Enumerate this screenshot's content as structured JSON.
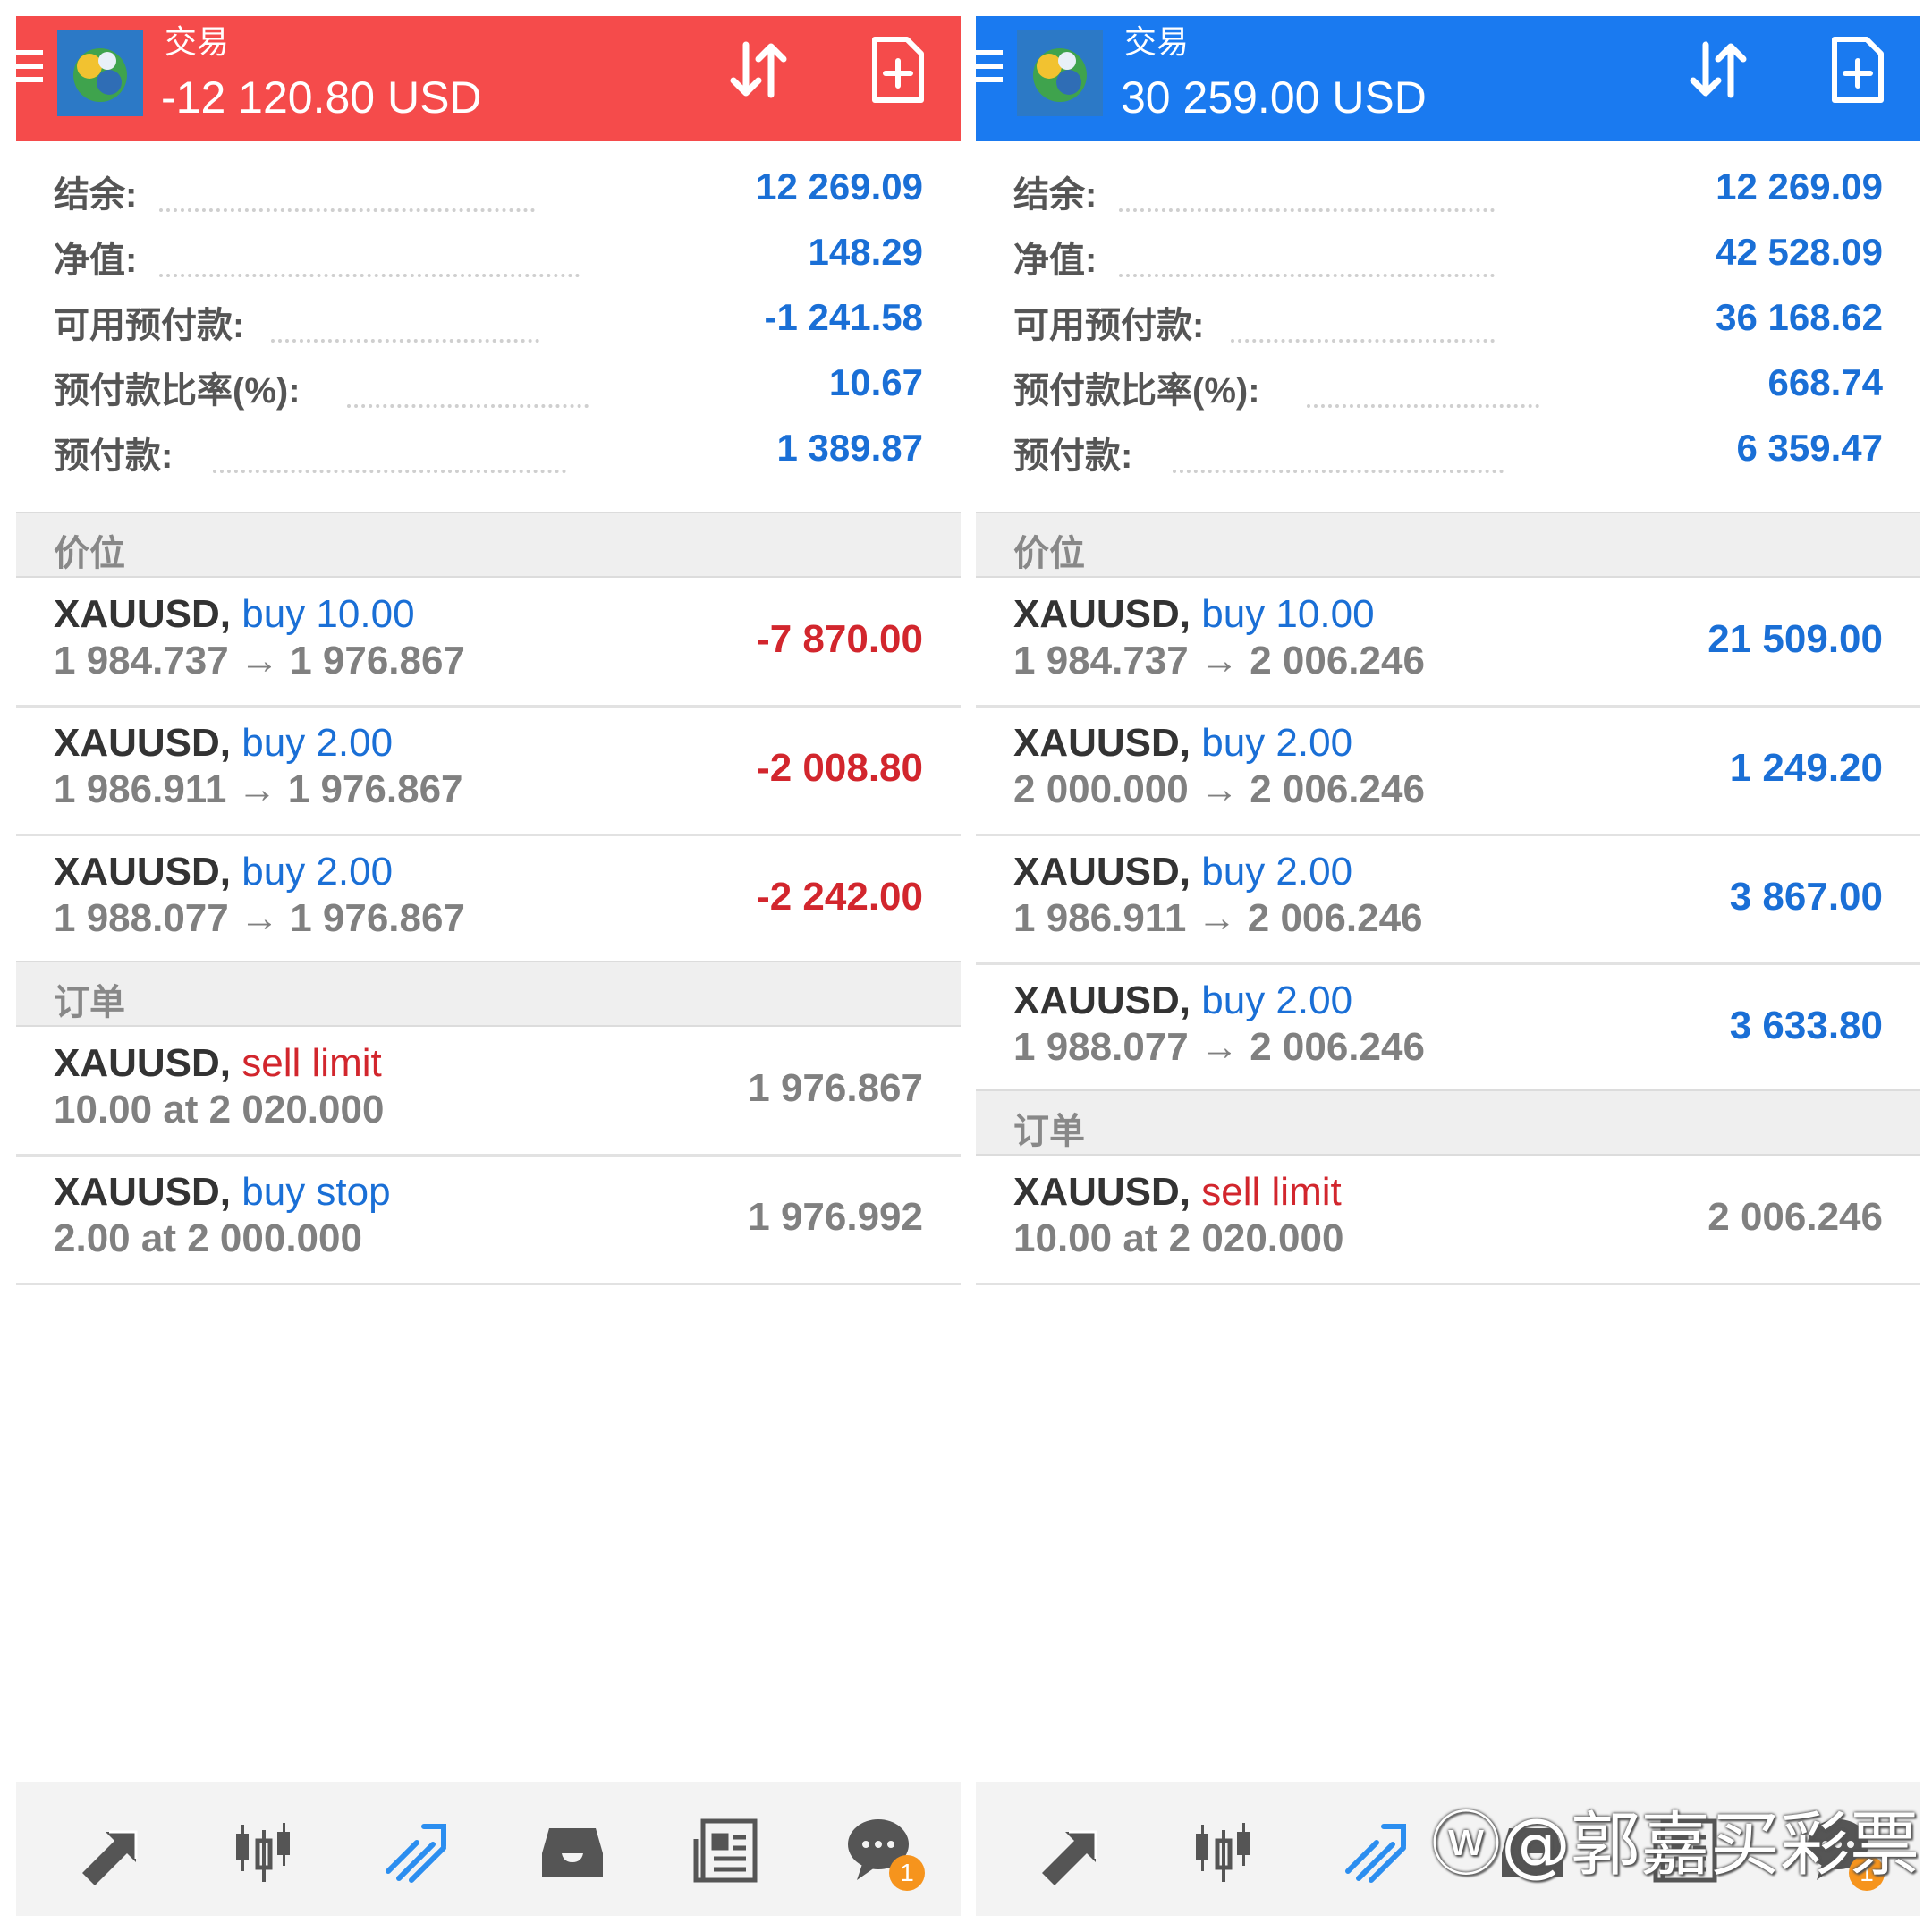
{
  "left": {
    "header": {
      "title": "交易",
      "amount": "-12 120.80 USD",
      "color": "#f54b4b"
    },
    "summary": [
      {
        "label": "结余:",
        "value": "12 269.09"
      },
      {
        "label": "净值:",
        "value": "148.29"
      },
      {
        "label": "可用预付款:",
        "value": "-1 241.58"
      },
      {
        "label": "预付款比率(%):",
        "value": "10.67"
      },
      {
        "label": "预付款:",
        "value": "1 389.87"
      }
    ],
    "positions_label": "价位",
    "positions": [
      {
        "symbol": "XAUUSD,",
        "side": "buy 10.00",
        "prices": "1 984.737 → 1 976.867",
        "profit": "-7 870.00"
      },
      {
        "symbol": "XAUUSD,",
        "side": "buy 2.00",
        "prices": "1 986.911 → 1 976.867",
        "profit": "-2 008.80"
      },
      {
        "symbol": "XAUUSD,",
        "side": "buy 2.00",
        "prices": "1 988.077 → 1 976.867",
        "profit": "-2 242.00"
      }
    ],
    "orders_label": "订单",
    "orders": [
      {
        "symbol": "XAUUSD,",
        "side": "sell limit",
        "detail": "10.00 at 2 020.000",
        "price": "1 976.867"
      },
      {
        "symbol": "XAUUSD,",
        "side": "buy stop",
        "detail": "2.00 at 2 000.000",
        "price": "1 976.992"
      }
    ],
    "chat_badge": "1"
  },
  "right": {
    "header": {
      "title": "交易",
      "amount": "30 259.00 USD",
      "color": "#1a7af0"
    },
    "summary": [
      {
        "label": "结余:",
        "value": "12 269.09"
      },
      {
        "label": "净值:",
        "value": "42 528.09"
      },
      {
        "label": "可用预付款:",
        "value": "36 168.62"
      },
      {
        "label": "预付款比率(%):",
        "value": "668.74"
      },
      {
        "label": "预付款:",
        "value": "6 359.47"
      }
    ],
    "positions_label": "价位",
    "positions": [
      {
        "symbol": "XAUUSD,",
        "side": "buy 10.00",
        "prices": "1 984.737 → 2 006.246",
        "profit": "21 509.00"
      },
      {
        "symbol": "XAUUSD,",
        "side": "buy 2.00",
        "prices": "2 000.000 → 2 006.246",
        "profit": "1 249.20"
      },
      {
        "symbol": "XAUUSD,",
        "side": "buy 2.00",
        "prices": "1 986.911 → 2 006.246",
        "profit": "3 867.00"
      },
      {
        "symbol": "XAUUSD,",
        "side": "buy 2.00",
        "prices": "1 988.077 → 2 006.246",
        "profit": "3 633.80"
      }
    ],
    "orders_label": "订单",
    "orders": [
      {
        "symbol": "XAUUSD,",
        "side": "sell limit",
        "detail": "10.00 at 2 020.000",
        "price": "2 006.246"
      }
    ],
    "chat_badge": "1"
  },
  "icons": {
    "menu": "hamburger-icon",
    "logo": "metatrader-logo-icon",
    "sort": "sort-arrows-icon",
    "new_order": "new-order-document-icon",
    "nav": [
      "quotes-arrows-icon",
      "chart-candles-icon",
      "trade-trend-icon",
      "history-inbox-icon",
      "news-icon",
      "chat-icon"
    ]
  },
  "colors": {
    "profit_negative": "#d2262d",
    "profit_positive": "#1a6fd6",
    "accent_blue": "#1a6fd6"
  },
  "watermark": "@郭嘉买彩票"
}
